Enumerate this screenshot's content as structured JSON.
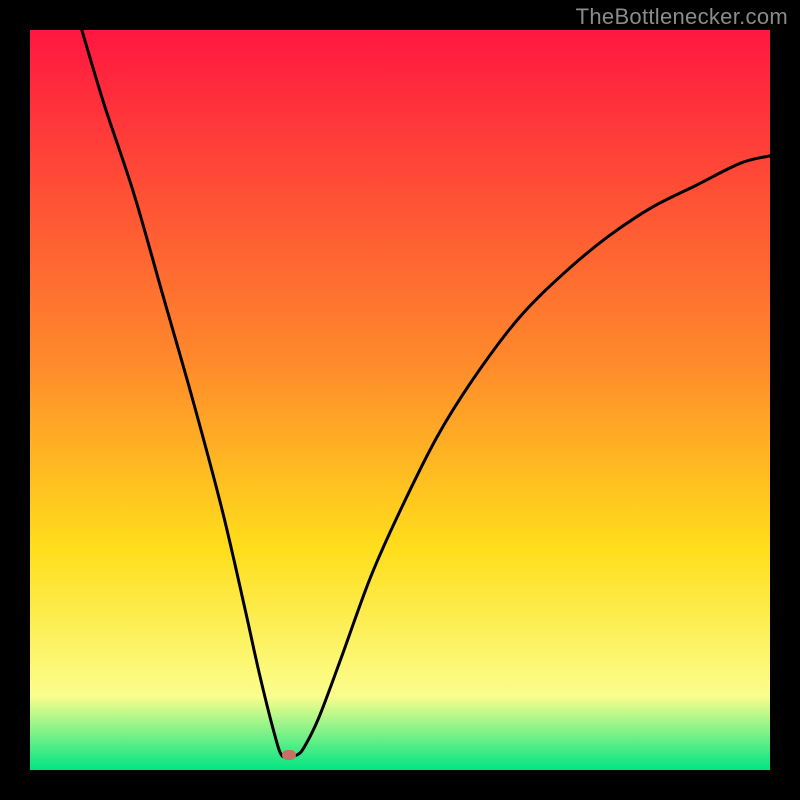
{
  "attribution": "TheBottlenecker.com",
  "colors": {
    "frame": "#000000",
    "gradient_top": "#ff1740",
    "gradient_mid1": "#ff8a2b",
    "gradient_mid2": "#ffde1b",
    "gradient_mid3": "#fbfe8d",
    "gradient_bottom": "#00e583",
    "curve": "#000000",
    "marker": "#c77064"
  },
  "chart_data": {
    "type": "line",
    "title": "",
    "xlabel": "",
    "ylabel": "",
    "xlim": [
      0,
      100
    ],
    "ylim": [
      0,
      100
    ],
    "marker": {
      "x": 35,
      "y": 2
    },
    "series": [
      {
        "name": "bottleneck-curve",
        "points": [
          {
            "x": 7,
            "y": 100
          },
          {
            "x": 10,
            "y": 90
          },
          {
            "x": 14,
            "y": 78
          },
          {
            "x": 18,
            "y": 64
          },
          {
            "x": 22,
            "y": 50
          },
          {
            "x": 26,
            "y": 35
          },
          {
            "x": 29,
            "y": 22
          },
          {
            "x": 31,
            "y": 13
          },
          {
            "x": 33,
            "y": 5
          },
          {
            "x": 34,
            "y": 2
          },
          {
            "x": 35,
            "y": 2
          },
          {
            "x": 36,
            "y": 2
          },
          {
            "x": 37,
            "y": 3
          },
          {
            "x": 39,
            "y": 7
          },
          {
            "x": 42,
            "y": 15
          },
          {
            "x": 46,
            "y": 26
          },
          {
            "x": 50,
            "y": 35
          },
          {
            "x": 55,
            "y": 45
          },
          {
            "x": 60,
            "y": 53
          },
          {
            "x": 66,
            "y": 61
          },
          {
            "x": 72,
            "y": 67
          },
          {
            "x": 78,
            "y": 72
          },
          {
            "x": 84,
            "y": 76
          },
          {
            "x": 90,
            "y": 79
          },
          {
            "x": 96,
            "y": 82
          },
          {
            "x": 100,
            "y": 83
          }
        ]
      }
    ]
  }
}
